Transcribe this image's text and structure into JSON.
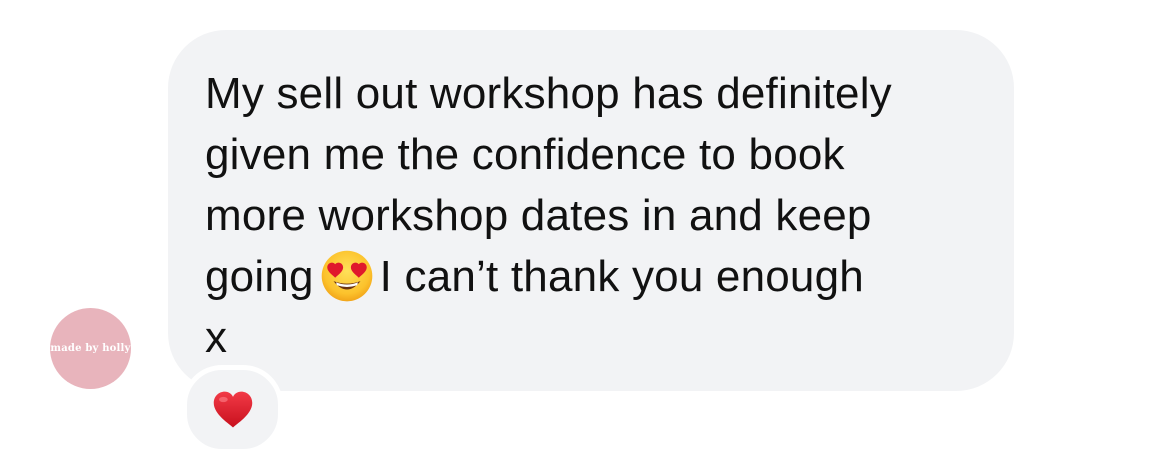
{
  "avatar": {
    "text": "made by holly",
    "color": "#e8b4bc"
  },
  "message": {
    "lines": [
      "My sell out workshop has definitely",
      "given me the confidence to book",
      "more workshop dates in and keep",
      "going",
      "I can’t thank you enough",
      "x"
    ],
    "inline_emoji": "heart-eyes-emoji",
    "bubble_color": "#f2f3f5"
  },
  "reaction": {
    "icon": "red-heart-icon",
    "color": "#e0182c"
  }
}
